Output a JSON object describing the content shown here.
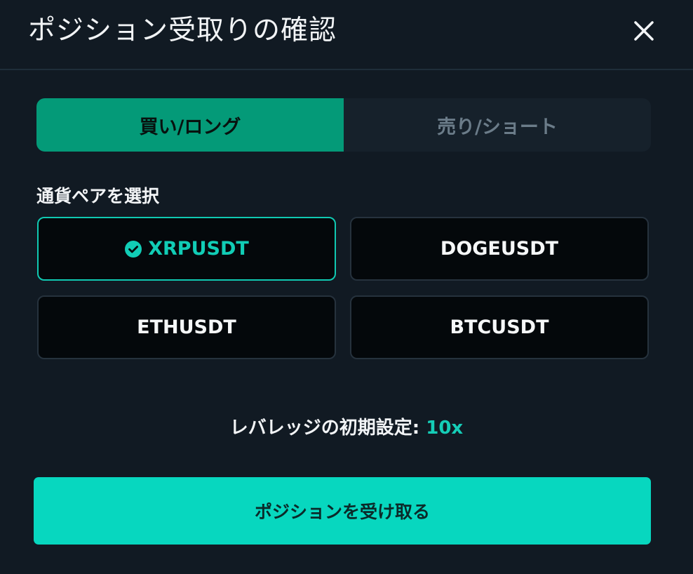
{
  "dialog": {
    "title": "ポジション受取りの確認",
    "close_icon": "close-icon"
  },
  "side_toggle": {
    "buy_label": "買い/ロング",
    "sell_label": "売り/ショート",
    "selected": "buy"
  },
  "pair_section": {
    "label": "通貨ペアを選択",
    "pairs": [
      {
        "label": "XRPUSDT",
        "selected": true,
        "icon": "check-circle-icon"
      },
      {
        "label": "DOGEUSDT",
        "selected": false
      },
      {
        "label": "ETHUSDT",
        "selected": false
      },
      {
        "label": "BTCUSDT",
        "selected": false
      }
    ]
  },
  "leverage": {
    "label": "レバレッジの初期設定:",
    "value": "10x"
  },
  "cta": {
    "label": "ポジションを受け取る"
  },
  "colors": {
    "background": "#111a23",
    "buy_active": "#049a78",
    "accent": "#07d7bf",
    "selected_text": "#11cdb6"
  }
}
